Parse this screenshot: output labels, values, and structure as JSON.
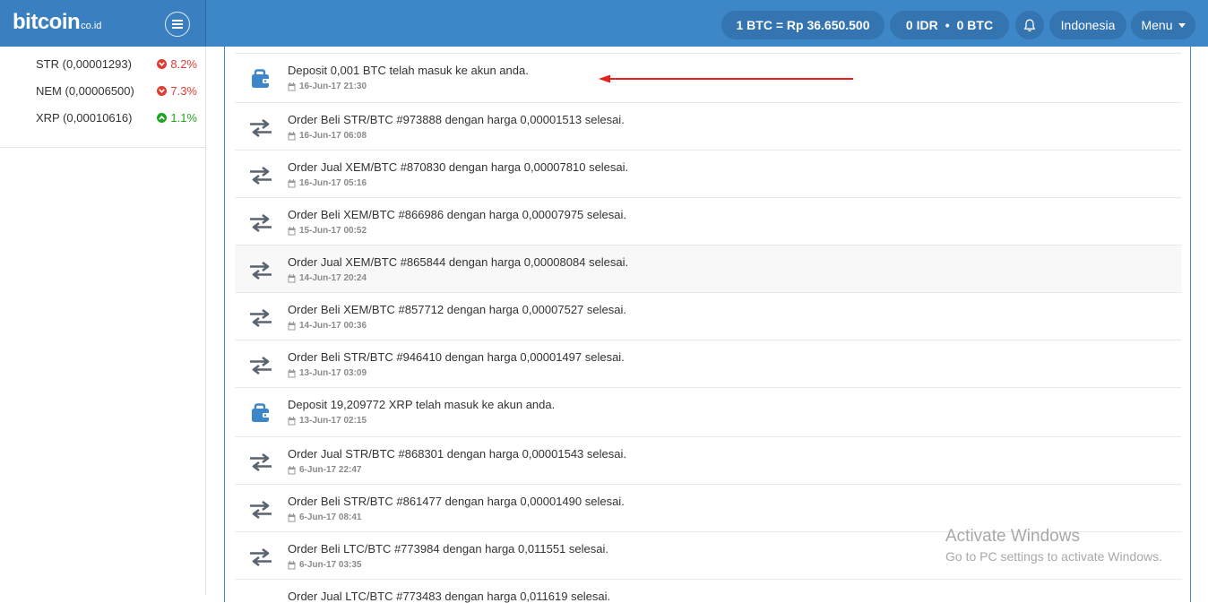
{
  "header": {
    "logo_text": "bitcoin",
    "logo_suffix": "co.id",
    "rate": "1 BTC = Rp 36.650.500",
    "balance_idr": "0 IDR",
    "balance_btc": "0 BTC",
    "language": "Indonesia",
    "menu_label": "Menu"
  },
  "sidebar": {
    "tickers": [
      {
        "pair": "STR (0,00001293)",
        "change": "8.2%",
        "direction": "down"
      },
      {
        "pair": "NEM (0,00006500)",
        "change": "7.3%",
        "direction": "down"
      },
      {
        "pair": "XRP (0,00010616)",
        "change": "1.1%",
        "direction": "up"
      }
    ]
  },
  "activity": [
    {
      "type": "deposit",
      "message": "Deposit 0,001 BTC telah masuk ke akun anda.",
      "time": "16-Jun-17 21:30"
    },
    {
      "type": "order",
      "message": "Order Beli STR/BTC #973888 dengan harga 0,00001513 selesai.",
      "time": "16-Jun-17 06:08"
    },
    {
      "type": "order",
      "message": "Order Jual XEM/BTC #870830 dengan harga 0,00007810 selesai.",
      "time": "16-Jun-17 05:16"
    },
    {
      "type": "order",
      "message": "Order Beli XEM/BTC #866986 dengan harga 0,00007975 selesai.",
      "time": "15-Jun-17 00:52"
    },
    {
      "type": "order",
      "message": "Order Jual XEM/BTC #865844 dengan harga 0,00008084 selesai.",
      "time": "14-Jun-17 20:24"
    },
    {
      "type": "order",
      "message": "Order Beli XEM/BTC #857712 dengan harga 0,00007527 selesai.",
      "time": "14-Jun-17 00:36"
    },
    {
      "type": "order",
      "message": "Order Beli STR/BTC #946410 dengan harga 0,00001497 selesai.",
      "time": "13-Jun-17 03:09"
    },
    {
      "type": "deposit",
      "message": "Deposit 19,209772 XRP telah masuk ke akun anda.",
      "time": "13-Jun-17 02:15"
    },
    {
      "type": "order",
      "message": "Order Jual STR/BTC #868301 dengan harga 0,00001543 selesai.",
      "time": "6-Jun-17 22:47"
    },
    {
      "type": "order",
      "message": "Order Beli STR/BTC #861477 dengan harga 0,00001490 selesai.",
      "time": "6-Jun-17 08:41"
    },
    {
      "type": "order",
      "message": "Order Beli LTC/BTC #773984 dengan harga 0,011551 selesai.",
      "time": "6-Jun-17 03:35"
    },
    {
      "type": "order",
      "message": "Order Jual LTC/BTC #773483 dengan harga 0,011619 selesai.",
      "time": ""
    }
  ],
  "watermark": {
    "line1": "Activate Windows",
    "line2": "Go to PC settings to activate Windows."
  },
  "colors": {
    "header_bg": "#3d87c8",
    "pill_bg": "#3474b0",
    "deposit_icon": "#3d87c8",
    "order_icon": "#5a6470",
    "down": "#e03c31",
    "up": "#23a323",
    "annotation_arrow": "#e8201c"
  },
  "icons": {
    "deposit": "wallet-icon",
    "order": "exchange-arrows-icon",
    "time": "calendar-icon",
    "notifications": "bell-icon",
    "sidebar_toggle": "hamburger-icon"
  }
}
